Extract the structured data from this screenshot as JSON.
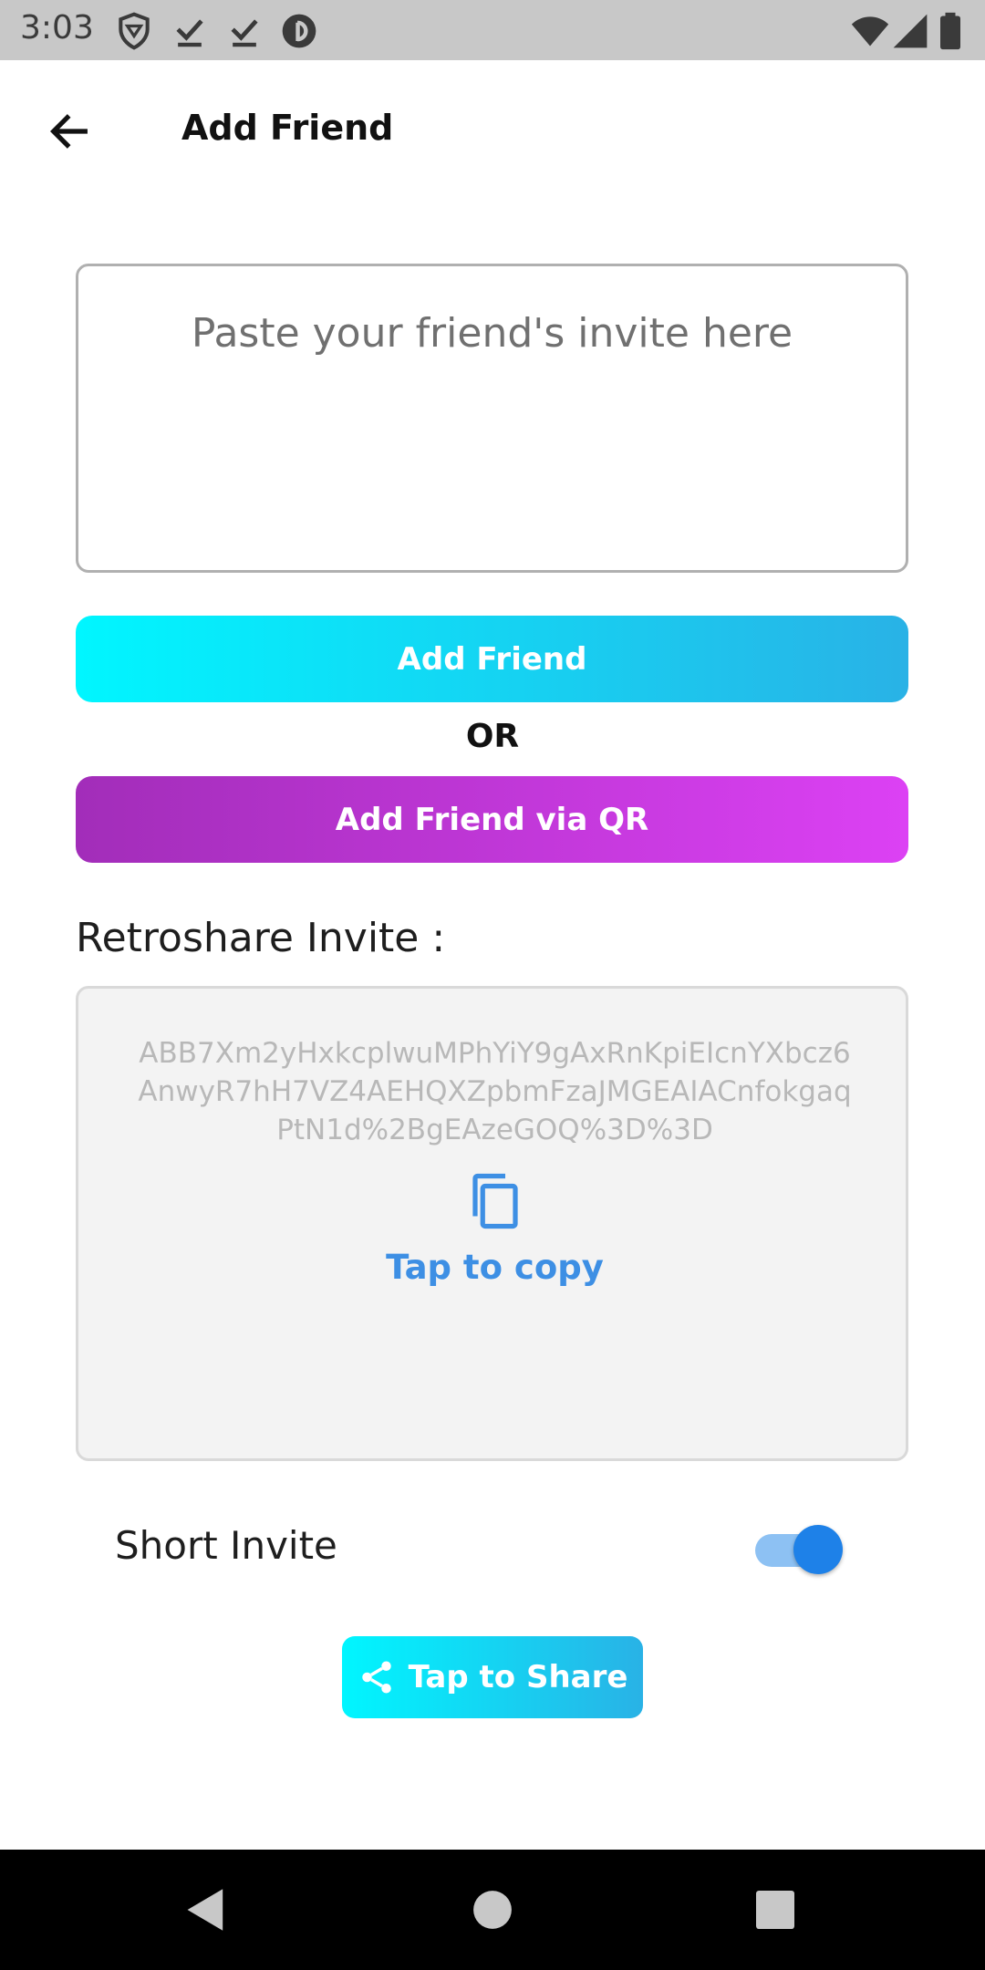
{
  "status_bar": {
    "time": "3:03",
    "left_icons": [
      "shield-icon",
      "download-done-icon",
      "download-done-icon",
      "pocket-casts-icon"
    ],
    "right_icons": [
      "wifi-icon",
      "signal-icon",
      "battery-icon"
    ]
  },
  "app_bar": {
    "title": "Add Friend",
    "back_icon": "arrow-left-icon"
  },
  "invite_input": {
    "placeholder": "Paste your friend's invite here",
    "value": ""
  },
  "buttons": {
    "add_friend": "Add Friend",
    "or": "OR",
    "add_friend_qr": "Add Friend via QR"
  },
  "invite_section": {
    "label": "Retroshare Invite :",
    "code": "ABB7Xm2yHxkcplwuMPhYiY9gAxRnKpiEIcnYXbcz6AnwyR7hH7VZ4AEHQXZpbmFzaJMGEAIACnfokgaqPtN1d%2BgEAzeGOQ%3D%3D",
    "copy_label": "Tap to copy",
    "copy_icon": "copy-icon"
  },
  "short_invite": {
    "label": "Short Invite",
    "enabled": true
  },
  "share": {
    "label": "Tap to Share",
    "icon": "share-icon"
  },
  "nav_bar": {
    "icons": [
      "back-triangle-icon",
      "home-circle-icon",
      "recents-square-icon"
    ]
  },
  "colors": {
    "accent_blue": "#3d8fe4",
    "cyan_start": "#00f6ff",
    "cyan_end": "#29b2e6",
    "purple_start": "#a22db9",
    "purple_end": "#dc41f4",
    "toggle_on": "#1e81e8"
  }
}
